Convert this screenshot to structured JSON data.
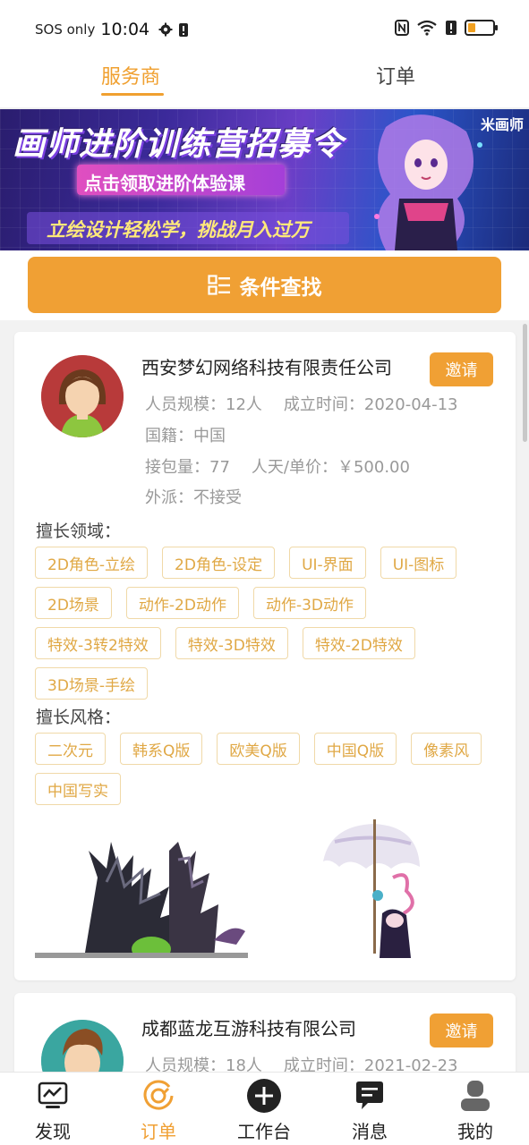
{
  "status_bar": {
    "carrier": "SOS only",
    "time": "10:04",
    "battery_level": 0.3
  },
  "top_tabs": [
    {
      "label": "服务商",
      "active": true
    },
    {
      "label": "订单",
      "active": false
    }
  ],
  "banner": {
    "title": "画师进阶训练营招募令",
    "subtitle": "点击领取进阶体验课",
    "tagline": "立绘设计轻松学，挑战月入过万",
    "logo": "米画师"
  },
  "search": {
    "label": "条件查找",
    "icon": "filter-list-icon"
  },
  "companies": [
    {
      "name": "西安梦幻网络科技有限责任公司",
      "invite_label": "邀请",
      "staff_label": "人员规模：",
      "staff": "12人",
      "founded_label": "成立时间：",
      "founded": "2020-04-13",
      "nationality_label": "国籍：",
      "nationality": "中国",
      "orders_label": "接包量：",
      "orders": "77",
      "price_label": "人天/单价：",
      "price": "￥500.00",
      "dispatch_label": "外派：",
      "dispatch": "不接受",
      "fields_label": "擅长领域：",
      "fields": [
        "2D角色-立绘",
        "2D角色-设定",
        "UI-界面",
        "UI-图标",
        "2D场景",
        "动作-2D动作",
        "动作-3D动作",
        "特效-3转2特效",
        "特效-3D特效",
        "特效-2D特效",
        "3D场景-手绘"
      ],
      "styles_label": "擅长风格：",
      "styles": [
        "二次元",
        "韩系Q版",
        "欧美Q版",
        "中国Q版",
        "像素风",
        "中国写实"
      ]
    },
    {
      "name": "成都蓝龙互游科技有限公司",
      "invite_label": "邀请",
      "staff_label": "人员规模：",
      "staff": "18人",
      "founded_label": "成立时间：",
      "founded": "2021-02-23"
    }
  ],
  "bottom_nav": [
    {
      "label": "发现",
      "icon": "chart-monitor-icon",
      "active": false
    },
    {
      "label": "订单",
      "icon": "order-ring-icon",
      "active": true
    },
    {
      "label": "工作台",
      "icon": "plus-circle-icon",
      "active": false
    },
    {
      "label": "消息",
      "icon": "message-bubble-icon",
      "active": false
    },
    {
      "label": "我的",
      "icon": "user-icon",
      "active": false
    }
  ],
  "colors": {
    "accent": "#f0a034",
    "tag_border": "#f0d9a8",
    "tag_text": "#e0a845",
    "muted_text": "#999999"
  }
}
